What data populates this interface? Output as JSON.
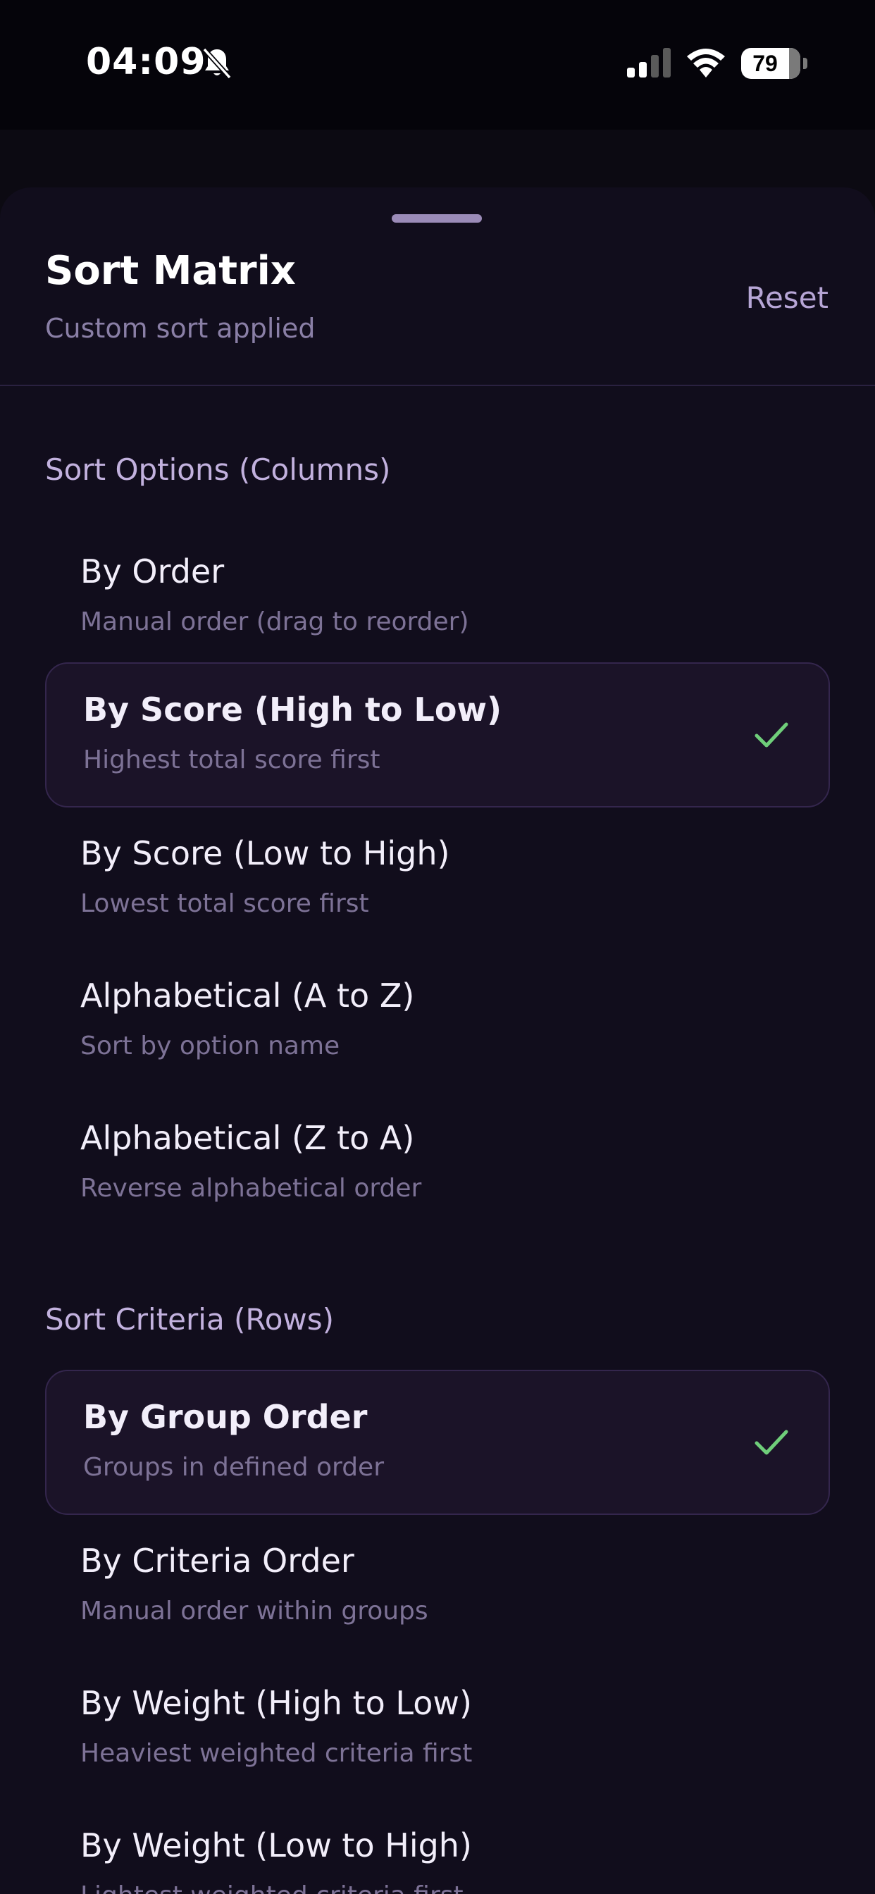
{
  "status_bar": {
    "time": "04:09",
    "battery": "79",
    "icons": [
      "bell-slash-icon",
      "cellular-signal-icon",
      "wifi-icon",
      "battery-icon"
    ]
  },
  "sheet": {
    "title": "Sort Matrix",
    "subtitle": "Custom sort applied",
    "reset_label": "Reset"
  },
  "columns_section": {
    "title": "Sort Options (Columns)",
    "options": [
      {
        "title": "By Order",
        "desc": "Manual order (drag to reorder)",
        "selected": false
      },
      {
        "title": "By Score (High to Low)",
        "desc": "Highest total score first",
        "selected": true
      },
      {
        "title": "By Score (Low to High)",
        "desc": "Lowest total score first",
        "selected": false
      },
      {
        "title": "Alphabetical (A to Z)",
        "desc": "Sort by option name",
        "selected": false
      },
      {
        "title": "Alphabetical (Z to A)",
        "desc": "Reverse alphabetical order",
        "selected": false
      }
    ]
  },
  "rows_section": {
    "title": "Sort Criteria (Rows)",
    "options": [
      {
        "title": "By Group Order",
        "desc": "Groups in defined order",
        "selected": true
      },
      {
        "title": "By Criteria Order",
        "desc": "Manual order within groups",
        "selected": false
      },
      {
        "title": "By Weight (High to Low)",
        "desc": "Heaviest weighted criteria first",
        "selected": false
      },
      {
        "title": "By Weight (Low to High)",
        "desc": "Lightest weighted criteria first",
        "selected": false
      }
    ]
  },
  "colors": {
    "accent_check": "#6fce7a",
    "selected_bg": "#1b1328",
    "sheet_bg": "#110d1c"
  }
}
